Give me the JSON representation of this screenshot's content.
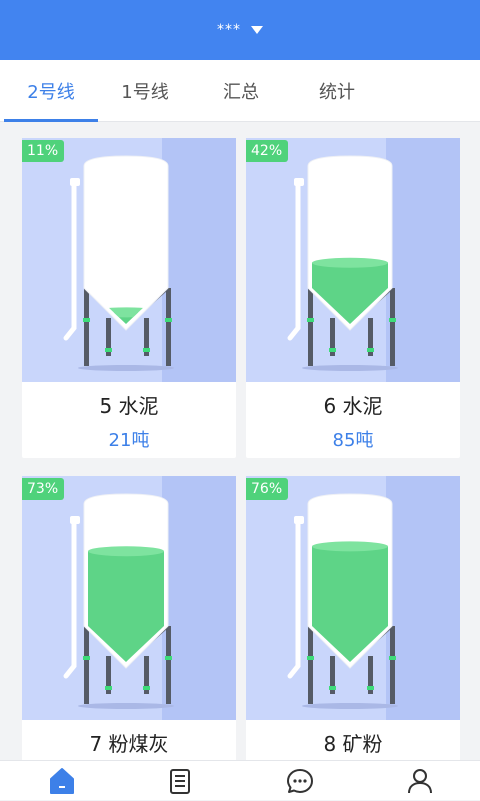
{
  "header": {
    "title": "***"
  },
  "tabs": [
    {
      "label": "2号线",
      "active": true
    },
    {
      "label": "1号线",
      "active": false
    },
    {
      "label": "汇总",
      "active": false
    },
    {
      "label": "统计",
      "active": false
    }
  ],
  "silos": [
    {
      "name": "5 水泥",
      "quantity": "21吨",
      "percent_label": "11%",
      "fill_fraction": 0.11
    },
    {
      "name": "6 水泥",
      "quantity": "85吨",
      "percent_label": "42%",
      "fill_fraction": 0.42
    },
    {
      "name": "7 粉煤灰",
      "quantity": "",
      "percent_label": "73%",
      "fill_fraction": 0.73
    },
    {
      "name": "8 矿粉",
      "quantity": "",
      "percent_label": "76%",
      "fill_fraction": 0.76
    }
  ],
  "bottom_nav": [
    {
      "icon": "home-icon",
      "active": true
    },
    {
      "icon": "document-list-icon",
      "active": false
    },
    {
      "icon": "chat-bubble-icon",
      "active": false
    },
    {
      "icon": "user-icon",
      "active": false
    }
  ],
  "colors": {
    "header": "#4284f0",
    "accent": "#3d80e8",
    "fill": "#5ed487",
    "badge": "#4fd27b",
    "card_bg": "#c9d6fb"
  }
}
